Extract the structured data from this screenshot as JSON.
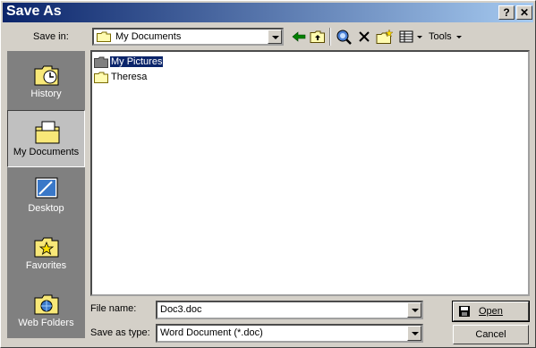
{
  "window": {
    "title": "Save As",
    "help_label": "?",
    "close_label": "✕"
  },
  "toolbar": {
    "save_in_label": "Save in:",
    "location": "My Documents",
    "tools_label": "Tools"
  },
  "places": [
    {
      "label": "History",
      "icon": "history-icon"
    },
    {
      "label": "My Documents",
      "icon": "my-documents-icon",
      "selected": true
    },
    {
      "label": "Desktop",
      "icon": "desktop-icon"
    },
    {
      "label": "Favorites",
      "icon": "favorites-icon"
    },
    {
      "label": "Web Folders",
      "icon": "web-folders-icon"
    }
  ],
  "files": [
    {
      "name": "My Pictures",
      "selected": true
    },
    {
      "name": "Theresa",
      "selected": false
    }
  ],
  "form": {
    "file_name_label": "File name:",
    "file_name_value": "Doc3.doc",
    "save_as_type_label": "Save as type:",
    "save_as_type_value": "Word Document (*.doc)"
  },
  "buttons": {
    "open_label": "Open",
    "cancel_label": "Cancel"
  },
  "colors": {
    "title_start": "#0a246a",
    "title_end": "#a6caf0",
    "places_bg": "#808080",
    "selection": "#0a246a"
  }
}
